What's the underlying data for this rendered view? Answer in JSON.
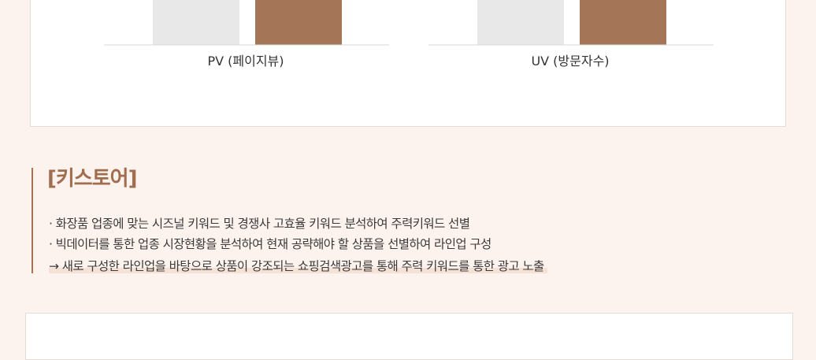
{
  "chart_data": [
    {
      "type": "bar",
      "categories": [
        ""
      ],
      "series": [
        {
          "values": [
            100
          ]
        },
        {
          "values": [
            100
          ]
        }
      ],
      "xlabel": "PV (페이지뷰)",
      "colors": [
        "#e8e8e8",
        "#a47556"
      ]
    },
    {
      "type": "bar",
      "categories": [
        ""
      ],
      "series": [
        {
          "values": [
            100
          ]
        },
        {
          "values": [
            100
          ]
        }
      ],
      "xlabel": "UV (방문자수)",
      "colors": [
        "#e8e8e8",
        "#a47556"
      ]
    }
  ],
  "section": {
    "title": "[키스토어]",
    "bullets": [
      "· 화장품 업종에 맞는 시즈널 키워드 및 경쟁사 고효율 키워드 분석하여 주력키워드 선별",
      "· 빅데이터를 통한 업종 시장현황을 분석하여 현재 공략해야 할 상품을 선별하여 라인업 구성"
    ],
    "result": "→ 새로 구성한 라인업을 바탕으로 상품이 강조되는 쇼핑검색광고를 통해 주력 키워드를 통한 광고 노출"
  },
  "colors": {
    "accent": "#a47556",
    "bar_light": "#e8e8e8",
    "background": "#fdf3ee"
  }
}
